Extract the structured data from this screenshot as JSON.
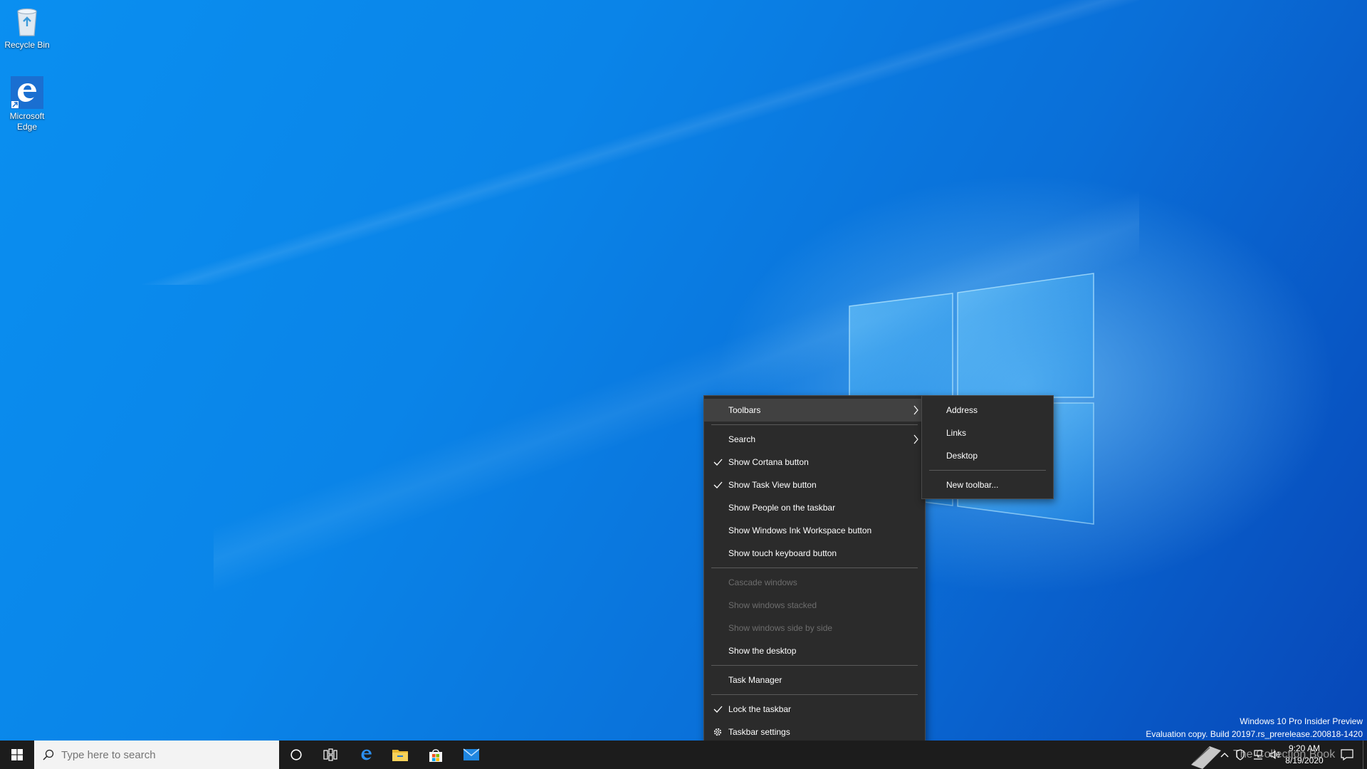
{
  "desktop": {
    "icons": [
      {
        "label": "Recycle Bin",
        "icon": "recycle-bin-icon"
      },
      {
        "label": "Microsoft\nEdge",
        "icon": "edge-icon"
      }
    ],
    "watermark": {
      "line1": "Windows 10 Pro Insider Preview",
      "line2": "Evaluation copy. Build 20197.rs_prerelease.200818-1420"
    }
  },
  "context_menu": {
    "items": [
      {
        "label": "Toolbars",
        "submenu": true,
        "highlighted": true
      },
      {
        "label": "Search",
        "submenu": true
      },
      {
        "label": "Show Cortana button",
        "checked": true
      },
      {
        "label": "Show Task View button",
        "checked": true
      },
      {
        "label": "Show People on the taskbar"
      },
      {
        "label": "Show Windows Ink Workspace button"
      },
      {
        "label": "Show touch keyboard button"
      },
      {
        "label": "Cascade windows",
        "disabled": true
      },
      {
        "label": "Show windows stacked",
        "disabled": true
      },
      {
        "label": "Show windows side by side",
        "disabled": true
      },
      {
        "label": "Show the desktop"
      },
      {
        "label": "Task Manager"
      },
      {
        "label": "Lock the taskbar",
        "checked": true
      },
      {
        "label": "Taskbar settings",
        "icon": "gear-icon"
      }
    ]
  },
  "toolbars_submenu": {
    "items": [
      {
        "label": "Address"
      },
      {
        "label": "Links"
      },
      {
        "label": "Desktop"
      },
      {
        "label": "New toolbar..."
      }
    ]
  },
  "taskbar": {
    "search_placeholder": "Type here to search",
    "pinned": [
      "cortana-icon",
      "task-view-icon",
      "edge-icon",
      "file-explorer-icon",
      "store-icon",
      "mail-icon"
    ],
    "clock": {
      "time": "9:20 AM",
      "date": "8/19/2020"
    },
    "tray_overlay_text": "The Collection Book"
  },
  "colors": {
    "menu_bg": "#2b2b2b",
    "menu_highlight": "#414141",
    "taskbar_bg": "#1c1c1c",
    "desktop_accent": "#0a84e8"
  }
}
